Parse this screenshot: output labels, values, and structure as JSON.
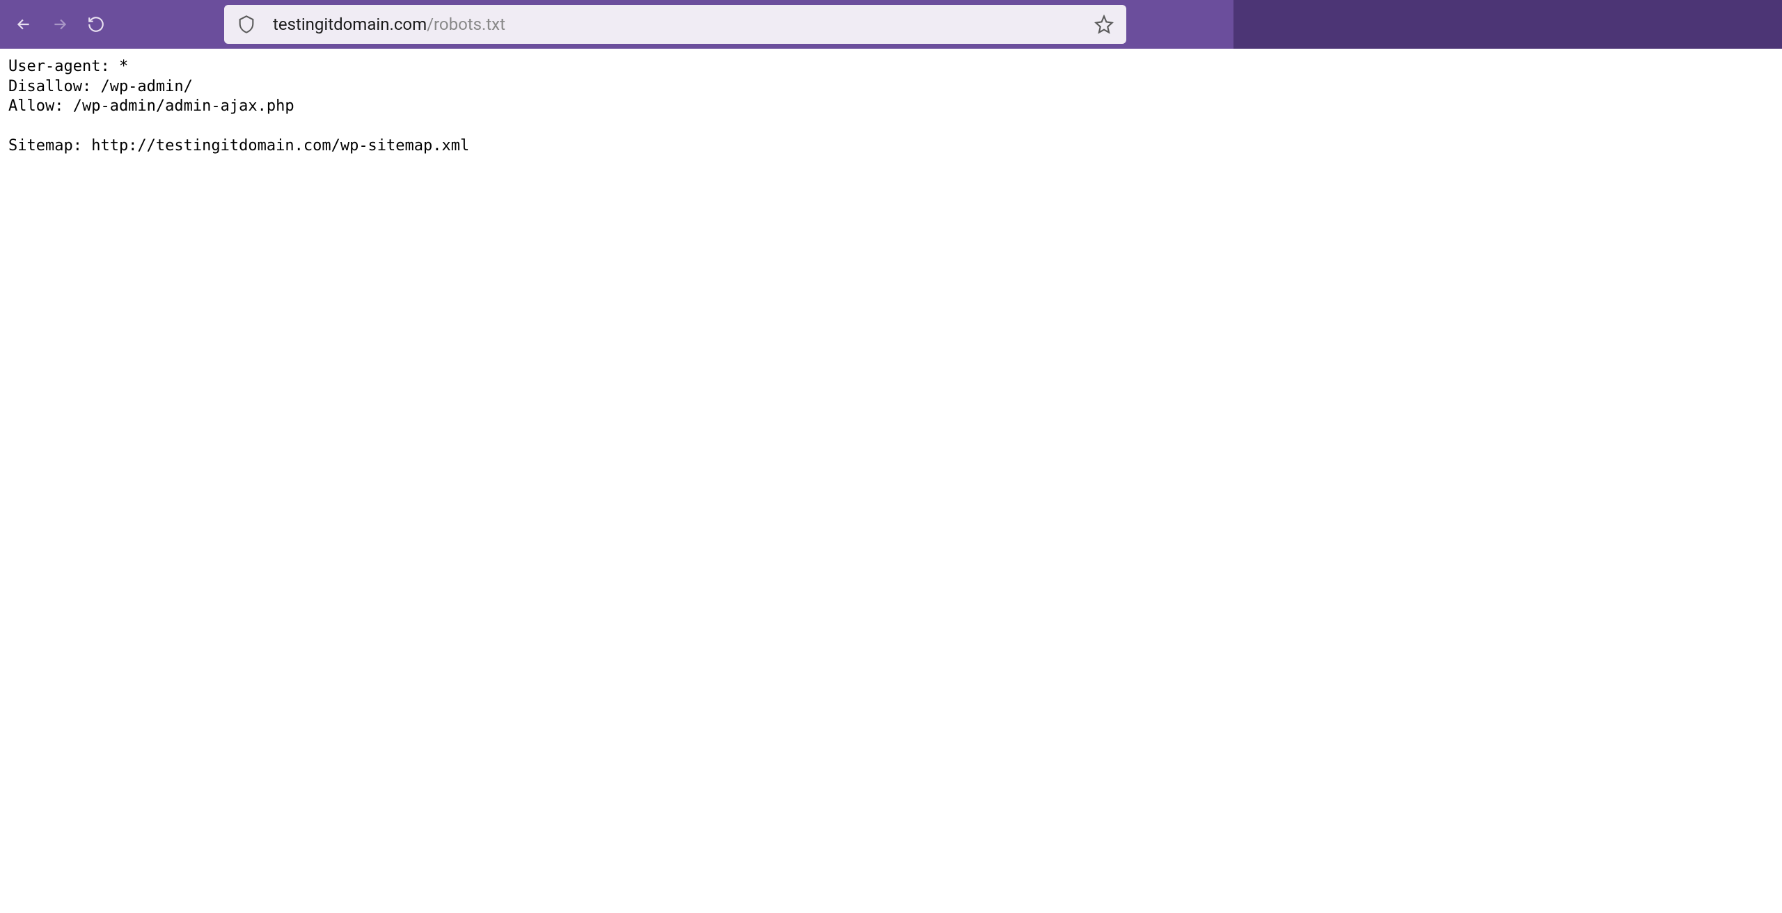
{
  "browser": {
    "url_domain": "testingitdomain.com",
    "url_path": "/robots.txt"
  },
  "page": {
    "line1": "User-agent: *",
    "line2": "Disallow: /wp-admin/",
    "line3": "Allow: /wp-admin/admin-ajax.php",
    "line4": "",
    "line5": "Sitemap: http://testingitdomain.com/wp-sitemap.xml"
  }
}
